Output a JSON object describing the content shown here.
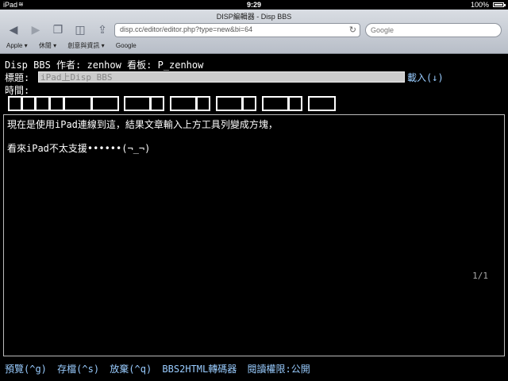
{
  "statusbar": {
    "carrier": "iPad",
    "time": "9:29",
    "battery": "100%"
  },
  "browser": {
    "page_title": "DISP編輯器 - Disp BBS",
    "url": "disp.cc/editor/editor.php?type=new&bi=64",
    "search_placeholder": "Google",
    "bookmarks": [
      "Apple ▾",
      "休閒 ▾",
      "創意與資訊 ▾",
      "Google"
    ]
  },
  "editor": {
    "board_line": {
      "site": "Disp BBS",
      "author_label": "作者:",
      "author": "zenhow",
      "board_label": "看板:",
      "board": "P_zenhow"
    },
    "title_label": "標題:",
    "title_value": "iPad上Disp BBS",
    "load_label": "載入(↓)",
    "time_label": "時間:",
    "content_lines": [
      "現在是使用iPad連線到這，結果文章輸入上方工具列變成方塊，",
      "",
      "看來iPad不太支援••••••(¬_¬)"
    ],
    "page_counter": "1/1",
    "bottom_menu": {
      "preview": "預覽(^g)",
      "save": "存檔(^s)",
      "discard": "放棄(^q)",
      "converter": "BBS2HTML轉碼器",
      "permission_label": "閱讀權限:",
      "permission_value": "公開"
    }
  }
}
